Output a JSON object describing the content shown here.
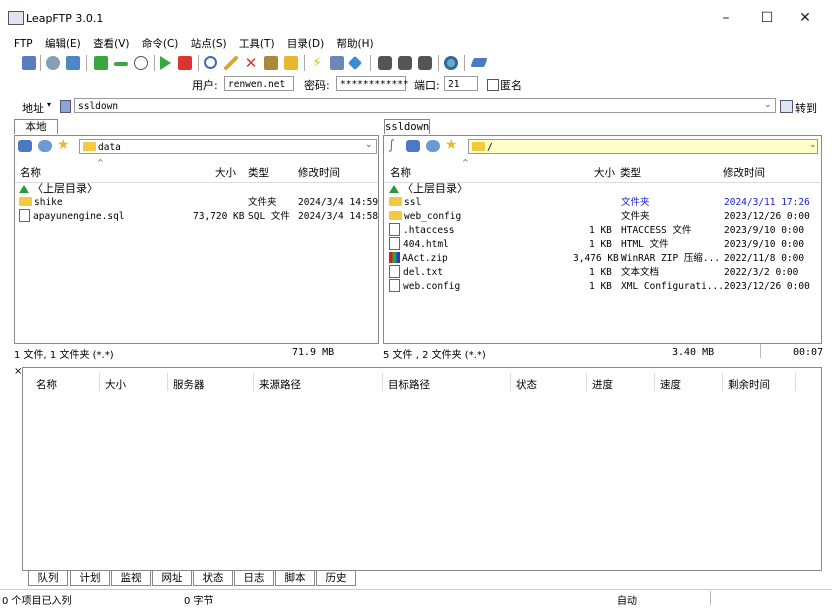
{
  "window": {
    "title": "LeapFTP 3.0.1"
  },
  "menu": [
    "FTP",
    "编辑(E)",
    "查看(V)",
    "命令(C)",
    "站点(S)",
    "工具(T)",
    "目录(D)",
    "帮助(H)"
  ],
  "connect": {
    "user_label": "用户:",
    "user_value": "renwen.net",
    "pass_label": "密码:",
    "pass_value": "************",
    "port_label": "端口:",
    "port_value": "21",
    "anon_label": "匿名"
  },
  "address": {
    "label": "地址",
    "value": "ssldown",
    "go_label": "转到"
  },
  "local": {
    "tab": "本地",
    "path": "data",
    "columns": [
      "名称",
      "大小",
      "类型",
      "修改时间"
    ],
    "parent": "〈上层目录〉",
    "rows": [
      {
        "name": "shike",
        "size": "",
        "type": "文件夹",
        "date": "2024/3/4 14:59"
      },
      {
        "name": "apayunengine.sql",
        "size": "73,720 KB",
        "type": "SQL 文件",
        "date": "2024/3/4 14:58"
      }
    ],
    "status_left": "1 文件, 1 文件夹 (*.*)",
    "status_size": "71.9 MB"
  },
  "remote": {
    "tab": "ssldown",
    "path": "/",
    "columns": [
      "名称",
      "大小",
      "类型",
      "修改时间"
    ],
    "parent": "〈上层目录〉",
    "rows": [
      {
        "name": "ssl",
        "size": "",
        "type": "文件夹",
        "date": "2024/3/11 17:26"
      },
      {
        "name": "web_config",
        "size": "",
        "type": "文件夹",
        "date": "2023/12/26 0:00"
      },
      {
        "name": ".htaccess",
        "size": "1 KB",
        "type": "HTACCESS 文件",
        "date": "2023/9/10 0:00"
      },
      {
        "name": "404.html",
        "size": "1 KB",
        "type": "HTML 文件",
        "date": "2023/9/10 0:00"
      },
      {
        "name": "AAct.zip",
        "size": "3,476 KB",
        "type": "WinRAR ZIP 压缩...",
        "date": "2022/11/8 0:00"
      },
      {
        "name": "del.txt",
        "size": "1 KB",
        "type": "文本文档",
        "date": "2022/3/2 0:00"
      },
      {
        "name": "web.config",
        "size": "1 KB",
        "type": "XML Configurati...",
        "date": "2023/12/26 0:00"
      }
    ],
    "status_left": "5 文件 , 2 文件夹 (*.*)",
    "status_size": "3.40 MB",
    "status_time": "00:07"
  },
  "queue": {
    "close": "×",
    "columns": [
      "名称",
      "大小",
      "服务器",
      "来源路径",
      "目标路径",
      "状态",
      "进度",
      "速度",
      "剩余时间"
    ],
    "tabs": [
      "队列",
      "计划",
      "监视",
      "网址",
      "状态",
      "日志",
      "脚本",
      "历史"
    ]
  },
  "statusbar": {
    "items": "0 个项目已入列",
    "bytes": "0 字节",
    "mode": "自动"
  },
  "colors": {
    "folder": "#f3c940",
    "selected_date": "#1a1ae0",
    "path_bg_remote": "#ffffc8"
  }
}
